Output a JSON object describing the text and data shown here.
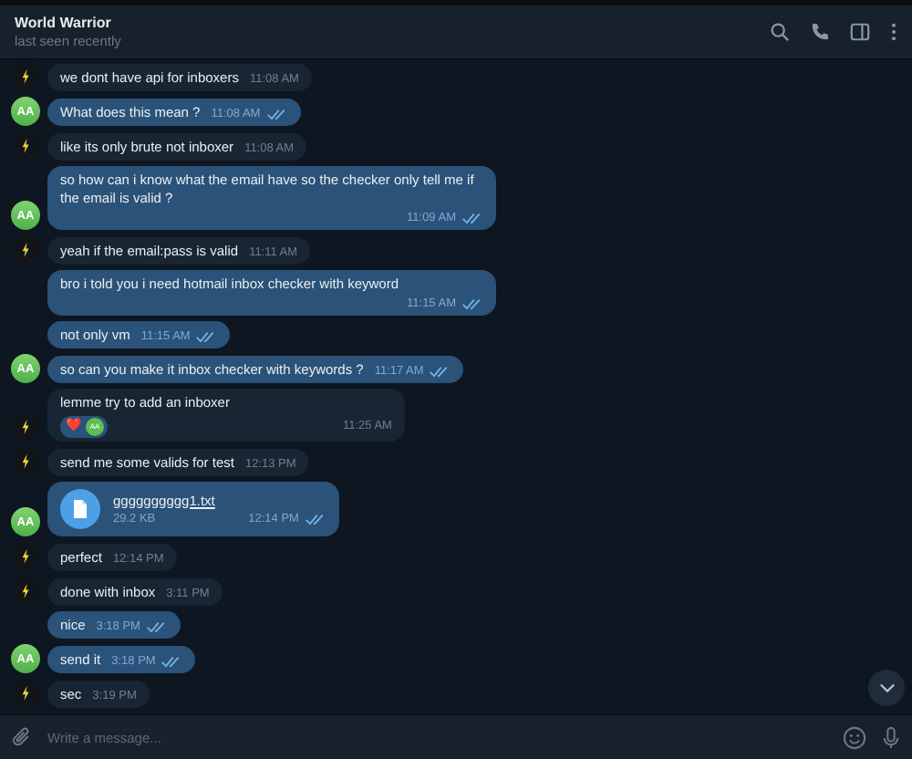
{
  "header": {
    "title": "World Warrior",
    "status": "last seen recently"
  },
  "messages": [
    {
      "outgoing": false,
      "kind": "text",
      "avatar": true,
      "text": "we dont have api for inboxers",
      "time": "11:08 AM"
    },
    {
      "outgoing": true,
      "kind": "text",
      "avatar": true,
      "avatar_text": "AA",
      "text": "What does this mean ?",
      "time": "11:08 AM",
      "read": true
    },
    {
      "outgoing": false,
      "kind": "text",
      "avatar": true,
      "text": "like its only brute not inboxer",
      "time": "11:08 AM"
    },
    {
      "outgoing": true,
      "kind": "text",
      "avatar": true,
      "avatar_text": "AA",
      "text": "so how can i know what the email have so the checker only tell me if the email is valid ?",
      "time": "11:09 AM",
      "read": true
    },
    {
      "outgoing": false,
      "kind": "text",
      "avatar": true,
      "text": "yeah if the email:pass is valid",
      "time": "11:11 AM"
    },
    {
      "outgoing": true,
      "kind": "text",
      "avatar": false,
      "text": "bro i told you i need hotmail inbox checker with keyword",
      "time": "11:15 AM",
      "read": true
    },
    {
      "outgoing": true,
      "kind": "text",
      "avatar": false,
      "text": "not only vm",
      "time": "11:15 AM",
      "read": true
    },
    {
      "outgoing": true,
      "kind": "text",
      "avatar": true,
      "avatar_text": "AA",
      "text": "so can you make it inbox checker with keywords ?",
      "time": "11:17 AM",
      "read": true
    },
    {
      "outgoing": false,
      "kind": "text",
      "avatar": true,
      "text": "lemme try to add an inboxer",
      "time": "11:25 AM",
      "reaction": {
        "emoji": "❤️",
        "avatar_text": "AA"
      }
    },
    {
      "outgoing": false,
      "kind": "text",
      "avatar": true,
      "text": "send me some valids for test",
      "time": "12:13 PM"
    },
    {
      "outgoing": true,
      "kind": "file",
      "avatar": true,
      "avatar_text": "AA",
      "file_name": "gggggggggg1.txt",
      "file_size": "29.2 KB",
      "time": "12:14 PM",
      "read": true
    },
    {
      "outgoing": false,
      "kind": "text",
      "avatar": true,
      "text": "perfect",
      "time": "12:14 PM"
    },
    {
      "outgoing": false,
      "kind": "text",
      "avatar": true,
      "text": "done with inbox",
      "time": "3:11 PM"
    },
    {
      "outgoing": true,
      "kind": "text",
      "avatar": false,
      "text": "nice",
      "time": "3:18 PM",
      "read": true
    },
    {
      "outgoing": true,
      "kind": "text",
      "avatar": true,
      "avatar_text": "AA",
      "text": "send it",
      "time": "3:18 PM",
      "read": true
    },
    {
      "outgoing": false,
      "kind": "text",
      "avatar": true,
      "text": "sec",
      "time": "3:19 PM"
    }
  ],
  "composer": {
    "placeholder": "Write a message..."
  }
}
